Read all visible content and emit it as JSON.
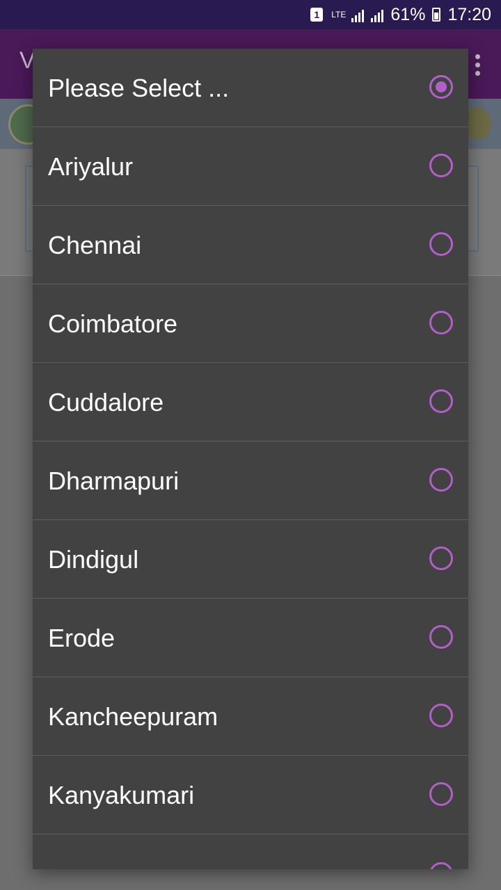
{
  "status_bar": {
    "sim_slot": "1",
    "network": "LTE",
    "battery": "61%",
    "time": "17:20"
  },
  "app_bar": {
    "title_initial": "V",
    "overflow_icon": "more-vert-icon"
  },
  "dialog": {
    "accent_color": "#b35fc9",
    "selected_index": 0,
    "options": [
      {
        "label": "Please Select ...",
        "checked": true
      },
      {
        "label": "Ariyalur",
        "checked": false
      },
      {
        "label": "Chennai",
        "checked": false
      },
      {
        "label": "Coimbatore",
        "checked": false
      },
      {
        "label": "Cuddalore",
        "checked": false
      },
      {
        "label": "Dharmapuri",
        "checked": false
      },
      {
        "label": "Dindigul",
        "checked": false
      },
      {
        "label": "Erode",
        "checked": false
      },
      {
        "label": "Kancheepuram",
        "checked": false
      },
      {
        "label": "Kanyakumari",
        "checked": false
      }
    ]
  }
}
